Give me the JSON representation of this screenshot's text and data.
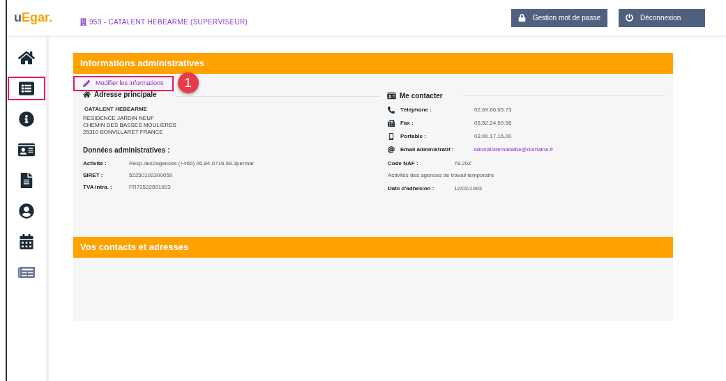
{
  "header": {
    "logo": {
      "prefix": "u",
      "rest": "Egar."
    },
    "account": "959 - CATALENT HEBEARME (SUPERVISEUR)",
    "buttons": [
      {
        "kind": "lock",
        "label": "Gestion mot de passe"
      },
      {
        "kind": "power",
        "label": "Déconnexion"
      }
    ]
  },
  "sidebar": {
    "items": [
      {
        "kind": "home",
        "selected": false
      },
      {
        "kind": "list",
        "selected": true
      },
      {
        "kind": "info",
        "selected": false
      },
      {
        "kind": "idcard",
        "selected": false
      },
      {
        "kind": "file",
        "selected": false
      },
      {
        "kind": "user",
        "selected": false
      },
      {
        "kind": "calendar",
        "selected": false
      },
      {
        "kind": "news",
        "selected": false
      }
    ]
  },
  "info_panel": {
    "title": "Informations administratives",
    "edit_link": {
      "label": "Modifier les informations",
      "highlighted": true
    },
    "callout": "1",
    "address": {
      "title": "Adresse principale",
      "name": "CATALENT HEBEARME",
      "lines": [
        "RESIDENCE JARDIN NEUF",
        "CHEMIN DES BASSES MOULIERES",
        "25310 BONVILLARET FRANCE"
      ]
    },
    "admin": {
      "title": "Données administratives :",
      "fields": [
        {
          "label": "Activité :",
          "value": "Resp.des2agences (+466) 06.84.0716.98.3permar"
        },
        {
          "label": "SIRET :",
          "value": "52250192300059"
        },
        {
          "label": "TVA intra. :",
          "value": "FR72522501923"
        }
      ]
    },
    "contact": {
      "title": "Me contacter",
      "fields": [
        {
          "kind": "phone",
          "label": "Téléphone :",
          "value": "02.69.66.65.73"
        },
        {
          "kind": "fax",
          "label": "Fax :",
          "value": "05.52.24.59.56"
        },
        {
          "kind": "mobile",
          "label": "Portable :",
          "value": "03.00.17.16.00"
        },
        {
          "kind": "email",
          "label": "Email administratif :",
          "value": "laboratoiremailalbe@domaine.fr"
        }
      ]
    },
    "naf": {
      "label": "Code NAF :",
      "value": "78.20Z",
      "description": "Activités des agences de travail temporaire"
    },
    "membership": {
      "label": "Date d'adhésion :",
      "value": "12/02/1993"
    }
  },
  "contacts_panel": {
    "title": "Vos contacts et adresses"
  }
}
